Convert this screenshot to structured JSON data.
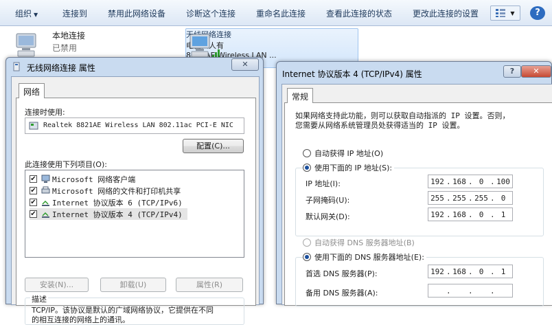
{
  "toolbar": {
    "items": [
      "组织",
      "连接到",
      "禁用此网络设备",
      "诊断这个连接",
      "重命名此连接",
      "查看此连接的状态",
      "更改此连接的设置"
    ],
    "organize_caret": "▼",
    "view_icon": "view-options-icon",
    "help_icon": "help-icon",
    "view_caret": "▼",
    "help_label": "?"
  },
  "connections": {
    "local": {
      "name": "本地连接",
      "status": "已禁用",
      "icon": "computer-network-icon"
    },
    "wireless": {
      "name": "无线网络连接",
      "status": "电脑人人有",
      "device": "8821AE Wireless LAN ...",
      "icon": "wireless-network-icon"
    }
  },
  "props_dialog": {
    "title": "无线网络连接 属性",
    "close": "✕",
    "tab": "网络",
    "connect_using_label": "连接时使用:",
    "adapter": "Realtek 8821AE Wireless LAN 802.11ac PCI-E NIC",
    "configure_button": "配置(C)...",
    "items_label": "此连接使用下列项目(O):",
    "items": [
      {
        "label": "Microsoft 网络客户端",
        "checked": "✔",
        "icon": "network-client-icon"
      },
      {
        "label": "Microsoft 网络的文件和打印机共享",
        "checked": "✔",
        "icon": "file-printer-share-icon"
      },
      {
        "label": "Internet 协议版本 6 (TCP/IPv6)",
        "checked": "✔",
        "icon": "protocol-icon"
      },
      {
        "label": "Internet 协议版本 4 (TCP/IPv4)",
        "checked": "✔",
        "icon": "protocol-icon"
      }
    ],
    "install_button": "安装(N)...",
    "uninstall_button": "卸载(U)",
    "properties_button": "属性(R)",
    "description_label": "描述",
    "description_text": "TCP/IP。该协议是默认的广域网络协议，它提供在不同",
    "description_text2": "的相互连接的网络上的通讯。"
  },
  "ipv4_dialog": {
    "title": "Internet 协议版本 4 (TCP/IPv4) 属性",
    "help": "?",
    "close": "✕",
    "tab": "常规",
    "intro_line1": "如果网络支持此功能，则可以获取自动指派的 IP 设置。否则，",
    "intro_line2": "您需要从网络系统管理员处获得适当的 IP 设置。",
    "auto_ip": "自动获得 IP 地址(O)",
    "manual_ip": "使用下面的 IP 地址(S):",
    "ip_label": "IP 地址(I):",
    "ip": [
      "192",
      "168",
      "0",
      "100"
    ],
    "mask_label": "子网掩码(U):",
    "mask": [
      "255",
      "255",
      "255",
      "0"
    ],
    "gateway_label": "默认网关(D):",
    "gateway": [
      "192",
      "168",
      "0",
      "1"
    ],
    "auto_dns": "自动获得 DNS 服务器地址(B)",
    "manual_dns": "使用下面的 DNS 服务器地址(E):",
    "preferred_dns_label": "首选 DNS 服务器(P):",
    "preferred_dns": [
      "192",
      "168",
      "0",
      "1"
    ],
    "alternate_dns_label": "备用 DNS 服务器(A):",
    "alternate_dns": [
      "",
      "",
      "",
      ""
    ],
    "dot": "."
  }
}
